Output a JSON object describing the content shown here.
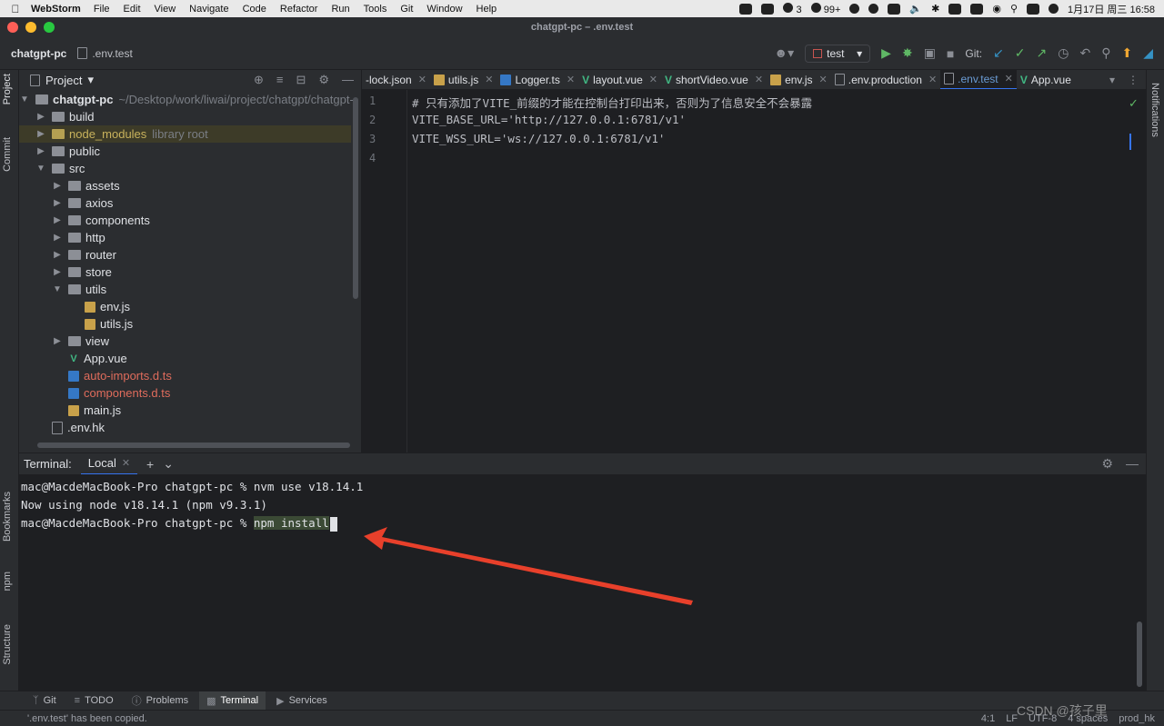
{
  "menubar": {
    "app_name": "WebStorm",
    "items": [
      "File",
      "Edit",
      "View",
      "Navigate",
      "Code",
      "Refactor",
      "Run",
      "Tools",
      "Git",
      "Window",
      "Help"
    ],
    "tray_badge_1": "3",
    "tray_badge_2": "99+",
    "datetime": "1月17日 周三  16:58"
  },
  "window": {
    "title": "chatgpt-pc – .env.test"
  },
  "toolbar": {
    "project_name": "chatgpt-pc",
    "current_file": ".env.test",
    "run_config": "test",
    "git_label": "Git:"
  },
  "project_panel": {
    "title": "Project",
    "root_name": "chatgpt-pc",
    "root_path": "~/Desktop/work/liwai/project/chatgpt/chatgpt-",
    "items": [
      {
        "label": "build"
      },
      {
        "label": "node_modules",
        "note": "library root"
      },
      {
        "label": "public"
      },
      {
        "label": "src"
      },
      {
        "label": "assets"
      },
      {
        "label": "axios"
      },
      {
        "label": "components"
      },
      {
        "label": "http"
      },
      {
        "label": "router"
      },
      {
        "label": "store"
      },
      {
        "label": "utils"
      },
      {
        "label": "env.js"
      },
      {
        "label": "utils.js"
      },
      {
        "label": "view"
      },
      {
        "label": "App.vue"
      },
      {
        "label": "auto-imports.d.ts"
      },
      {
        "label": "components.d.ts"
      },
      {
        "label": "main.js"
      },
      {
        "label": ".env.hk"
      }
    ]
  },
  "editor_tabs": [
    {
      "label": "-lock.json"
    },
    {
      "label": "utils.js"
    },
    {
      "label": "Logger.ts"
    },
    {
      "label": "layout.vue"
    },
    {
      "label": "shortVideo.vue"
    },
    {
      "label": "env.js"
    },
    {
      "label": ".env.production"
    },
    {
      "label": ".env.test"
    },
    {
      "label": "App.vue"
    }
  ],
  "editor": {
    "line_numbers": [
      "1",
      "2",
      "3",
      "4"
    ],
    "lines": [
      "# 只有添加了VITE_前缀的才能在控制台打印出来，否则为了信息安全不会暴露",
      "VITE_BASE_URL='http://127.0.0.1:6781/v1'",
      "VITE_WSS_URL='ws://127.0.0.1:6781/v1'",
      ""
    ]
  },
  "terminal": {
    "label": "Terminal:",
    "tab": "Local",
    "prompt": "mac@MacdeMacBook-Pro chatgpt-pc % ",
    "line1_cmd": "nvm use v18.14.1",
    "line2": "Now using node v18.14.1 (npm v9.3.1)",
    "line3_cmd": "npm install"
  },
  "side_tools": {
    "left_top": [
      "Project",
      "Commit"
    ],
    "left_bottom": [
      "Bookmarks",
      "npm",
      "Structure"
    ],
    "right": [
      "Notifications"
    ]
  },
  "bottom_tools": [
    {
      "label": "Git",
      "icon": "git-icon"
    },
    {
      "label": "TODO",
      "icon": "list-icon"
    },
    {
      "label": "Problems",
      "icon": "info-icon"
    },
    {
      "label": "Terminal",
      "icon": "terminal-icon"
    },
    {
      "label": "Services",
      "icon": "play-icon"
    }
  ],
  "statusbar": {
    "message": "'.env.test' has been copied.",
    "position": "4:1",
    "line_ending": "LF",
    "encoding": "UTF-8",
    "indent": "4 spaces",
    "branch": "prod_hk"
  },
  "watermark": "CSDN @孩子里"
}
